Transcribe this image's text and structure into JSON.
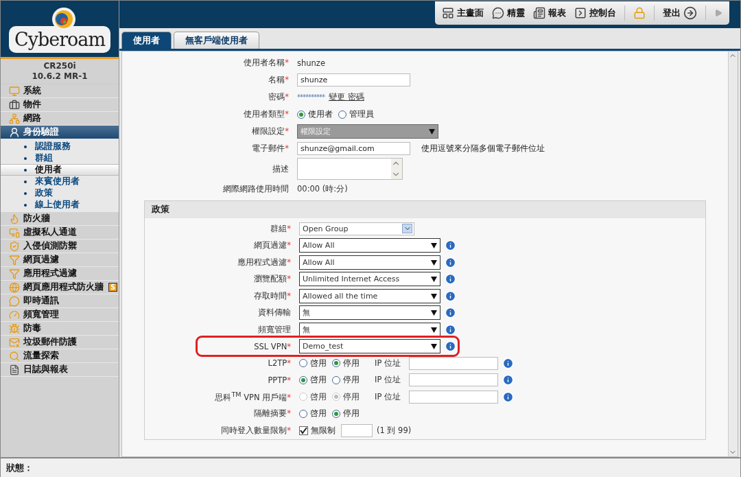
{
  "brand": {
    "name": "Cyberoam",
    "product": "CR250i",
    "version": "10.6.2 MR-1"
  },
  "toolbar": [
    {
      "kind": "button",
      "label": "主畫面"
    },
    {
      "kind": "button",
      "label": "精靈"
    },
    {
      "kind": "button",
      "label": "報表"
    },
    {
      "kind": "button",
      "label": "控制台"
    },
    {
      "kind": "lock"
    },
    {
      "kind": "button",
      "label": "登出"
    }
  ],
  "sidebar": {
    "items": [
      {
        "label": "系統",
        "selected": false
      },
      {
        "label": "物件",
        "selected": false
      },
      {
        "label": "網路",
        "selected": false
      },
      {
        "label": "身份驗證",
        "selected": true,
        "expanded": true,
        "children": [
          {
            "label": "認證服務",
            "selected": false
          },
          {
            "label": "群組",
            "selected": false
          },
          {
            "label": "使用者",
            "selected": true
          },
          {
            "label": "來賓使用者",
            "selected": false
          },
          {
            "label": "政策",
            "selected": false
          },
          {
            "label": "線上使用者",
            "selected": false
          }
        ]
      },
      {
        "label": "防火牆",
        "selected": false
      },
      {
        "label": "虛擬私人通道",
        "selected": false
      },
      {
        "label": "入侵偵測防禦",
        "selected": false
      },
      {
        "label": "網頁過濾",
        "selected": false
      },
      {
        "label": "應用程式過濾",
        "selected": false
      },
      {
        "label": "網頁應用程式防火牆",
        "selected": false,
        "badge": "S"
      },
      {
        "label": "即時通訊",
        "selected": false
      },
      {
        "label": "頻寬管理",
        "selected": false
      },
      {
        "label": "防毒",
        "selected": false
      },
      {
        "label": "垃圾郵件防護",
        "selected": false
      },
      {
        "label": "流量探索",
        "selected": false
      },
      {
        "label": "日誌與報表",
        "selected": false
      }
    ]
  },
  "tabs": [
    {
      "label": "使用者",
      "selected": true
    },
    {
      "label": "無客戶端使用者",
      "selected": false
    }
  ],
  "user_form": [
    {
      "kind": "static",
      "label": "使用者名稱",
      "mark": "*",
      "value": "shunze"
    },
    {
      "kind": "input",
      "label": "名稱",
      "mark": "*",
      "value": "shunze"
    },
    {
      "kind": "password",
      "label": "密碼",
      "mark": "*",
      "value": "**********",
      "link": "變更 密碼"
    },
    {
      "kind": "radio",
      "label": "使用者類型",
      "mark": "*",
      "options": [
        {
          "label": "使用者",
          "selected": true
        },
        {
          "label": "管理員",
          "selected": false
        }
      ]
    },
    {
      "kind": "select",
      "label": "權限設定",
      "mark": "*",
      "value": "權限設定",
      "disabled": true
    },
    {
      "kind": "input",
      "label": "電子郵件",
      "mark": "*",
      "value": "shunze@gmail.com",
      "hint": "使用逗號來分隔多個電子郵件位址"
    },
    {
      "kind": "textarea",
      "label": "描述"
    },
    {
      "kind": "static",
      "label": "網際網路使用時間",
      "value": "00:00 (時:分)"
    }
  ],
  "policy": {
    "title": "政策",
    "rows": [
      {
        "kind": "combo",
        "label": "群組",
        "mark": "*",
        "value": "Open Group"
      },
      {
        "kind": "select",
        "label": "網頁過濾 ",
        "mark": "*",
        "value": "Allow All",
        "info": true
      },
      {
        "kind": "select",
        "label": "應用程式過濾",
        "mark": "*",
        "value": "Allow All",
        "info": true
      },
      {
        "kind": "select",
        "label": "瀏覽配額",
        "mark": "*",
        "value": "Unlimited Internet Access",
        "info": true
      },
      {
        "kind": "select",
        "label": "存取時間",
        "mark": "*",
        "value": "Allowed all the time",
        "info": true
      },
      {
        "kind": "select",
        "label": "資料傳輸",
        "value": "無",
        "info": true
      },
      {
        "kind": "select",
        "label": "頻寬管理",
        "value": "無",
        "info": true
      },
      {
        "kind": "select",
        "label": "SSL VPN ",
        "mark": "*",
        "value": "Demo_test",
        "info": true,
        "highlighted": true
      },
      {
        "kind": "radio",
        "label": "L2TP",
        "mark": "*",
        "options": [
          {
            "label": "啓用",
            "selected": false
          },
          {
            "label": "停用",
            "selected": true
          }
        ],
        "ip_label": "IP 位址",
        "info": true
      },
      {
        "kind": "radio",
        "label": "PPTP",
        "mark": "*",
        "options": [
          {
            "label": "啓用",
            "selected": true
          },
          {
            "label": "停用",
            "selected": false
          }
        ],
        "ip_label": "IP 位址",
        "info": true
      },
      {
        "kind": "radio",
        "label": "思科$^{TM}$ VPN 用戶端",
        "mark": "*",
        "disabled": true,
        "options": [
          {
            "label": "啓用",
            "selected": false
          },
          {
            "label": "停用",
            "selected": true
          }
        ],
        "ip_label": "IP 位址",
        "info": true
      },
      {
        "kind": "radio",
        "label": "隔離摘要",
        "mark": "*",
        "options": [
          {
            "label": "啓用",
            "selected": false
          },
          {
            "label": "停用",
            "selected": true
          }
        ]
      },
      {
        "kind": "checkbox",
        "label": "同時登入數量限制",
        "mark": "*",
        "checked": true,
        "option": "無限制",
        "hint": "(1 到 99)"
      }
    ]
  },
  "status_bar": {
    "label": "狀態："
  }
}
